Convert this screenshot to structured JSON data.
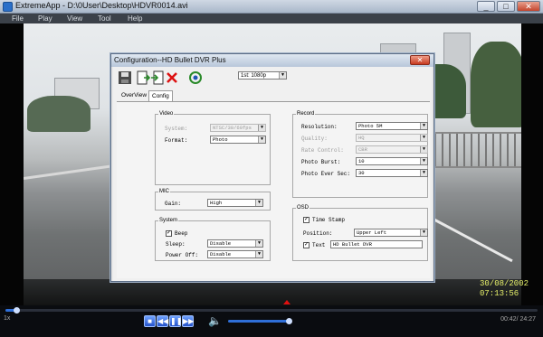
{
  "window": {
    "title": "ExtremeApp - D:\\0User\\Desktop\\HDVR0014.avi",
    "minimize": "_",
    "maximize": "□",
    "close": "✕"
  },
  "menu": [
    "File",
    "Play",
    "View",
    "Tool",
    "Help"
  ],
  "overlay": {
    "date": "30/08/2002",
    "time": "07:13:56"
  },
  "player": {
    "speed": "1x",
    "time": "00:42/ 24:27",
    "progress_fraction": 0.02,
    "volume_fraction": 0.95,
    "buttons": [
      "stop",
      "rewind",
      "pause",
      "fast-forward"
    ]
  },
  "dialog": {
    "title": "Configuration--HD Bullet DVR Plus",
    "close": "✕",
    "resolution_select": "1st: 1080p",
    "tabs": [
      "OverView",
      "Config"
    ],
    "active_tab": "Config",
    "video": {
      "legend": "Video",
      "system_label": "System:",
      "system_value": "NTSC/30/60fps",
      "format_label": "Format:",
      "format_value": "Photo"
    },
    "mic": {
      "legend": "MIC",
      "gain_label": "Gain:",
      "gain_value": "High"
    },
    "system": {
      "legend": "System",
      "beep_label": "Beep",
      "beep_checked": true,
      "sleep_label": "Sleep:",
      "sleep_value": "Disable",
      "poweroff_label": "Power Off:",
      "poweroff_value": "Disable"
    },
    "record": {
      "legend": "Record",
      "resolution_label": "Resolution:",
      "resolution_value": "Photo 5M",
      "quality_label": "Quality:",
      "quality_value": "HQ",
      "rate_label": "Rate Control:",
      "rate_value": "CBR",
      "burst_label": "Photo Burst:",
      "burst_value": "10",
      "ever_label": "Photo Ever Sec:",
      "ever_value": "30"
    },
    "osd": {
      "legend": "OSD",
      "timestamp_label": "Time Stamp",
      "timestamp_checked": true,
      "position_label": "Position:",
      "position_value": "Upper Left",
      "text_label": "Text",
      "text_checked": true,
      "text_value": "HD Bullet DVR"
    }
  },
  "colors": {
    "accent": "#2f6fd8",
    "overlay_text": "#e6f06a",
    "close_red": "#c73a20"
  }
}
